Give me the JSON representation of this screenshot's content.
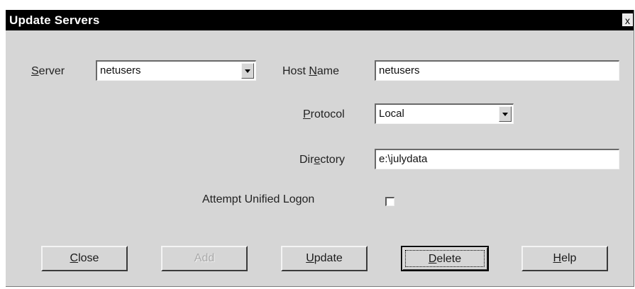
{
  "window": {
    "title": "Update Servers",
    "close_glyph": "x"
  },
  "form": {
    "server": {
      "label_pre": "",
      "label_u": "S",
      "label_post": "erver",
      "value": "netusers"
    },
    "host_name": {
      "label_pre": "Host ",
      "label_u": "N",
      "label_post": "ame",
      "value": "netusers"
    },
    "protocol": {
      "label_pre": "",
      "label_u": "P",
      "label_post": "rotocol",
      "value": "Local"
    },
    "directory": {
      "label_pre": "Dir",
      "label_u": "e",
      "label_post": "ctory",
      "value": "e:\\julydata"
    },
    "unified_logon": {
      "label": "Attempt Unified Logon",
      "checked": false
    }
  },
  "buttons": {
    "close": {
      "label_u": "C",
      "label_post": "lose"
    },
    "add": {
      "label": "Add"
    },
    "update": {
      "label_u": "U",
      "label_post": "pdate"
    },
    "delete": {
      "label_u": "D",
      "label_post": "elete"
    },
    "help": {
      "label_u": "H",
      "label_post": "elp"
    }
  },
  "icons": {
    "combo_arrow": "chevron-down-icon",
    "window_close": "close-icon"
  }
}
